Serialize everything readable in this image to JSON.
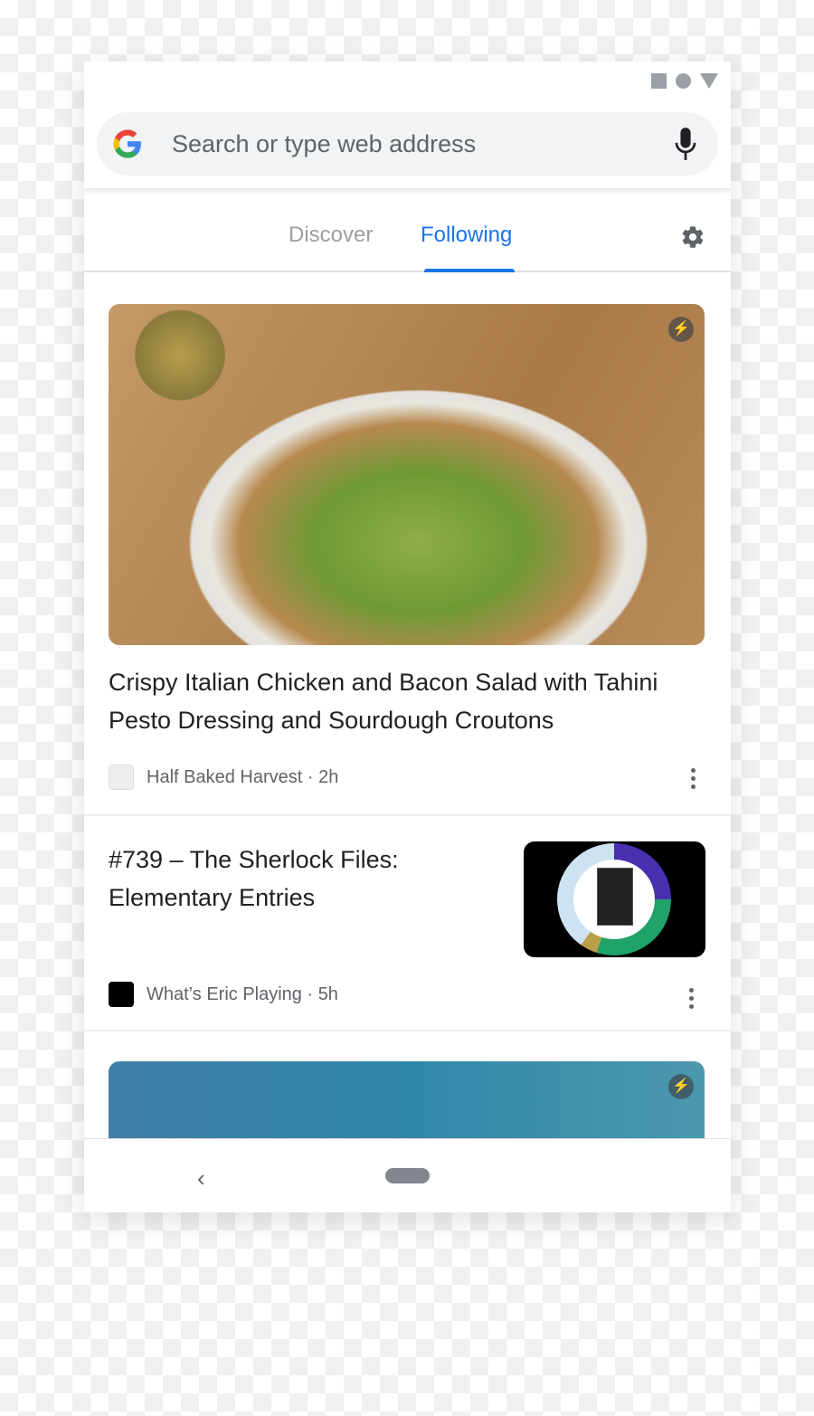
{
  "search": {
    "placeholder": "Search or type web address"
  },
  "tabs": [
    {
      "label": "Discover",
      "active": false
    },
    {
      "label": "Following",
      "active": true
    }
  ],
  "accent": "#1a73e8",
  "feed": [
    {
      "title": "Crispy Italian Chicken and Bacon Salad with Tahini Pesto Dressing and Sourdough Croutons",
      "source": "Half Baked Harvest · 2h",
      "amp": true
    },
    {
      "title": "#739 – The Sherlock Files: Elementary Entries",
      "source": "What’s Eric Playing · 5h"
    },
    {
      "amp": true
    }
  ],
  "icons": [
    "status-square-icon",
    "status-circle-icon",
    "status-triangle-icon",
    "google-g-icon",
    "mic-icon",
    "gear-icon",
    "amp-bolt-icon",
    "more-vert-icon",
    "back-icon",
    "home-pill-icon"
  ]
}
